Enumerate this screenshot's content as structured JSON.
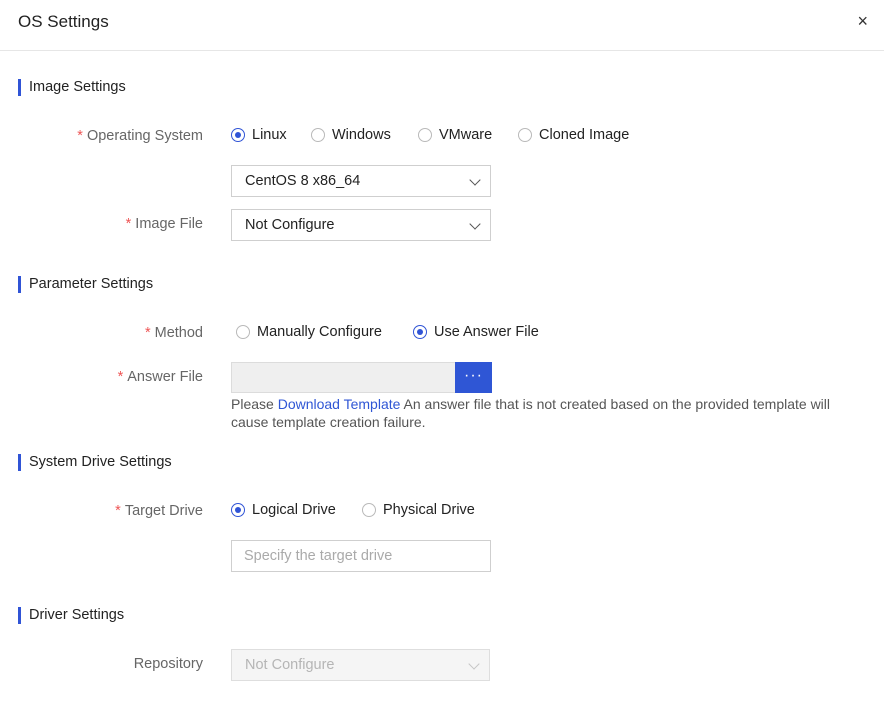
{
  "dialog": {
    "title": "OS Settings",
    "close_glyph": "×"
  },
  "image_settings": {
    "title": "Image Settings",
    "os_label": "Operating System",
    "os_options": [
      "Linux",
      "Windows",
      "VMware",
      "Cloned Image"
    ],
    "os_selected": "Linux",
    "os_version": "CentOS 8 x86_64",
    "image_file_label": "Image File",
    "image_file_value": "Not Configure"
  },
  "parameter_settings": {
    "title": "Parameter Settings",
    "method_label": "Method",
    "method_options": [
      "Manually Configure",
      "Use Answer File"
    ],
    "method_selected": "Use Answer File",
    "answer_file_label": "Answer File",
    "answer_file_value": "",
    "browse_glyph": "···",
    "hint_prefix": "Please ",
    "hint_link": "Download Template",
    "hint_suffix": " An answer file that is not created based on the provided template will cause template creation failure."
  },
  "system_drive_settings": {
    "title": "System Drive Settings",
    "target_label": "Target Drive",
    "target_options": [
      "Logical Drive",
      "Physical Drive"
    ],
    "target_selected": "Logical Drive",
    "target_placeholder": "Specify the target drive"
  },
  "driver_settings": {
    "title": "Driver Settings",
    "repository_label": "Repository",
    "repository_value": "Not Configure"
  },
  "required_mark": "*",
  "colors": {
    "accent": "#3054d6",
    "required": "#ee5555"
  }
}
